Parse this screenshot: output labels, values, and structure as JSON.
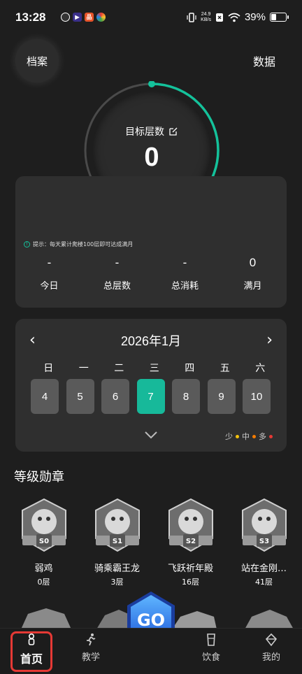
{
  "status": {
    "time": "13:28",
    "net_speed_value": "24.9",
    "net_speed_unit": "KB/s",
    "battery": "39%",
    "battery_level": 0.39
  },
  "header": {
    "archive_label": "档案",
    "data_label": "数据"
  },
  "goal": {
    "label": "目标层数",
    "value": "0",
    "progress": 0.48,
    "accent": "#14c29b"
  },
  "stats": {
    "tip": "提示：每天累计爬楼100层即可达成满月",
    "items": [
      {
        "value": "-",
        "label": "今日"
      },
      {
        "value": "-",
        "label": "总层数"
      },
      {
        "value": "-",
        "label": "总消耗"
      },
      {
        "value": "0",
        "label": "满月"
      }
    ]
  },
  "calendar": {
    "title": "2026年1月",
    "weekdays": [
      "日",
      "一",
      "二",
      "三",
      "四",
      "五",
      "六"
    ],
    "days": [
      "4",
      "5",
      "6",
      "7",
      "8",
      "9",
      "10"
    ],
    "selected_day": "7",
    "legend": [
      {
        "label": "少",
        "color": "#f4c20d"
      },
      {
        "label": "中",
        "color": "#f57c00"
      },
      {
        "label": "多",
        "color": "#e53935"
      }
    ]
  },
  "badges": {
    "title": "等级勋章",
    "items": [
      {
        "name": "弱鸡",
        "floors": "0层",
        "tier": "S0"
      },
      {
        "name": "骑乘霸王龙",
        "floors": "3层",
        "tier": "S1"
      },
      {
        "name": "飞跃祈年殿",
        "floors": "16层",
        "tier": "S2"
      },
      {
        "name": "站在金刚…",
        "floors": "41层",
        "tier": "S3"
      }
    ]
  },
  "go_button": "GO",
  "nav": {
    "items": [
      {
        "label": "首页",
        "icon": "home-icon"
      },
      {
        "label": "教学",
        "icon": "running-icon"
      },
      {
        "label": "饮食",
        "icon": "cup-icon"
      },
      {
        "label": "我的",
        "icon": "profile-icon"
      }
    ]
  }
}
